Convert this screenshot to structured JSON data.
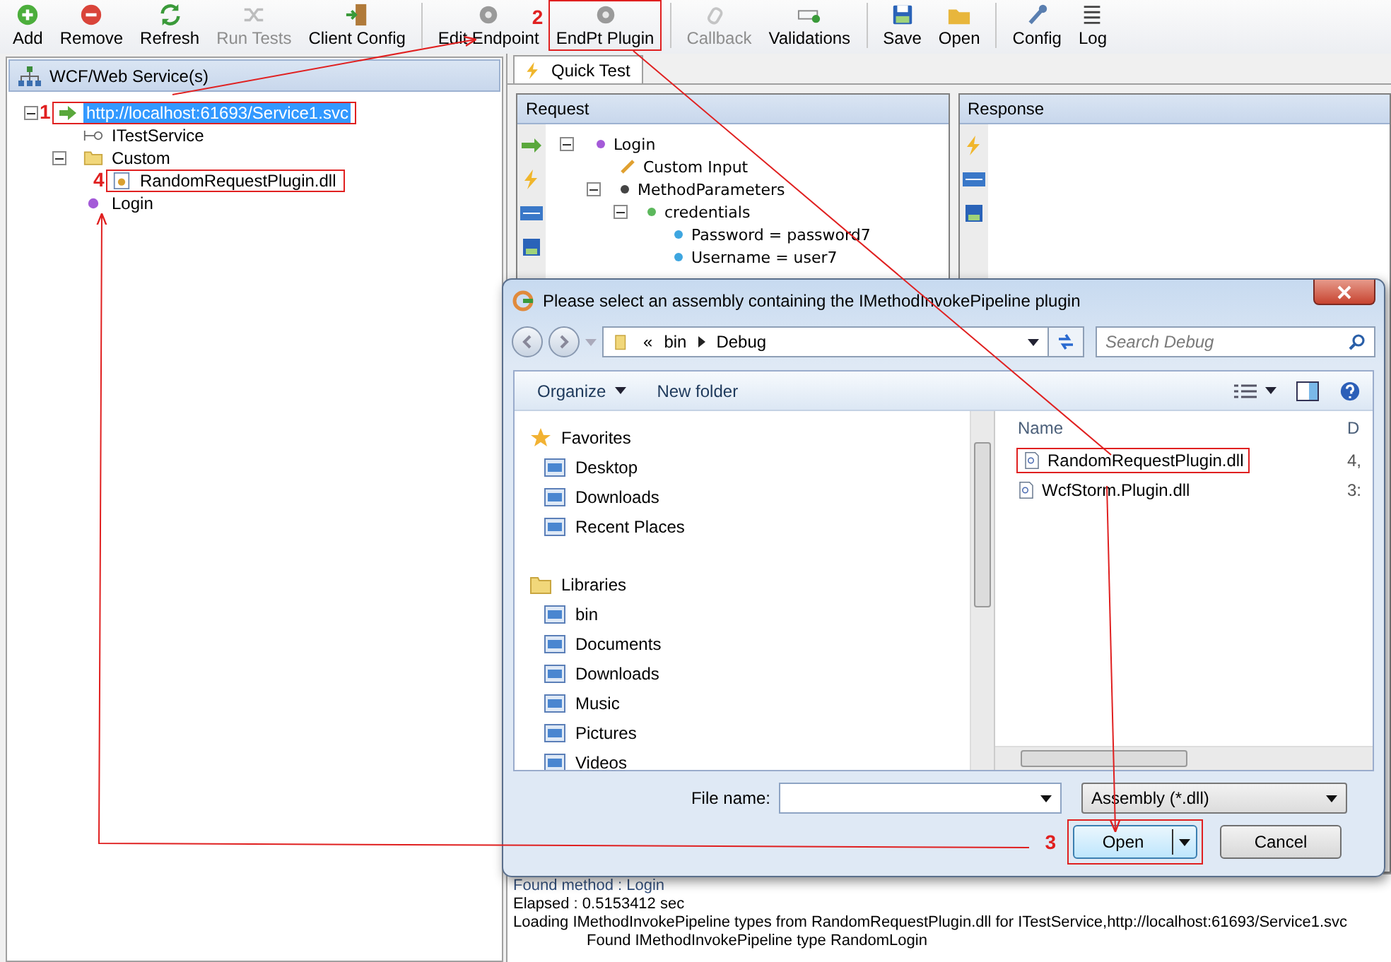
{
  "toolbar": [
    [
      {
        "label": "Add",
        "disabled": false,
        "boxed": false
      },
      {
        "label": "Remove",
        "disabled": false,
        "boxed": false
      },
      {
        "label": "Refresh",
        "disabled": false,
        "boxed": false
      },
      {
        "label": "Run Tests",
        "disabled": true,
        "boxed": false
      },
      {
        "label": "Client Config",
        "disabled": false,
        "boxed": false
      }
    ],
    [
      {
        "label": "Edit Endpoint",
        "disabled": false,
        "boxed": false
      },
      {
        "label": "EndPt Plugin",
        "disabled": false,
        "boxed": true,
        "callout": "2"
      }
    ],
    [
      {
        "label": "Callback",
        "disabled": true,
        "boxed": false
      },
      {
        "label": "Validations",
        "disabled": false,
        "boxed": false
      }
    ],
    [
      {
        "label": "Save",
        "disabled": false,
        "boxed": false
      },
      {
        "label": "Open",
        "disabled": false,
        "boxed": false
      }
    ],
    [
      {
        "label": "Config",
        "disabled": false,
        "boxed": false
      },
      {
        "label": "Log",
        "disabled": false,
        "boxed": false
      }
    ]
  ],
  "services": {
    "title": "WCF/Web Service(s)",
    "tree": [
      {
        "label": "http://localhost:61693/Service1.svc",
        "selected": true,
        "boxed": true,
        "callout": "1",
        "expanded": true,
        "children": [
          {
            "label": "ITestService",
            "selected": false,
            "boxed": false
          },
          {
            "label": "Custom",
            "selected": false,
            "boxed": false,
            "expanded": true,
            "children": [
              {
                "label": "RandomRequestPlugin.dll",
                "selected": false,
                "boxed": true,
                "callout": "4"
              }
            ]
          },
          {
            "label": "Login",
            "selected": false,
            "boxed": false
          }
        ]
      }
    ]
  },
  "tabs": [
    {
      "label": "Quick Test",
      "selected": true
    }
  ],
  "request": {
    "title": "Request",
    "tree": [
      {
        "label": "Login",
        "expanded": true,
        "children": [
          {
            "label": "Custom Input"
          },
          {
            "label": "MethodParameters",
            "expanded": true,
            "children": [
              {
                "label": "credentials",
                "expanded": true,
                "children": [
                  {
                    "label": "Password = password7"
                  },
                  {
                    "label": "Username = user7"
                  }
                ]
              }
            ]
          }
        ]
      }
    ]
  },
  "response": {
    "title": "Response"
  },
  "log": [
    {
      "text": "Found method : Login",
      "kind": "line"
    },
    {
      "text": "Elapsed : 0.5153412 sec",
      "kind": "line"
    },
    {
      "text": "Loading IMethodInvokePipeline types from RandomRequestPlugin.dll for ITestService,http://localhost:61693/Service1.svc",
      "kind": "line"
    },
    {
      "text": "Found IMethodInvokePipeline type RandomLogin",
      "kind": "detail"
    }
  ],
  "dialog": {
    "title": "Please select an assembly containing the IMethodInvokePipeline plugin",
    "breadcrumb_prefix": "«",
    "breadcrumb": [
      "bin",
      "Debug"
    ],
    "search": {
      "placeholder": "Search Debug"
    },
    "commands": [
      "Organize",
      "New folder"
    ],
    "nav": [
      {
        "label": "Favorites",
        "children": [
          "Desktop",
          "Downloads",
          "Recent Places"
        ]
      },
      {
        "label": "Libraries",
        "children": [
          "bin",
          "Documents",
          "Downloads",
          "Music",
          "Pictures",
          "Videos"
        ]
      }
    ],
    "columns": [
      "Name",
      "D"
    ],
    "files": [
      {
        "name": "RandomRequestPlugin.dll",
        "column_2": "4,",
        "boxed": true
      },
      {
        "name": "WcfStorm.Plugin.dll",
        "column_2": "3:",
        "boxed": false
      }
    ],
    "file_name_label": "File name:",
    "filter": "Assembly (*.dll)",
    "buttons": [
      {
        "label": "Open",
        "kind": "split",
        "boxed": true,
        "callout": "3"
      },
      {
        "label": "Cancel",
        "kind": "plain"
      }
    ]
  }
}
